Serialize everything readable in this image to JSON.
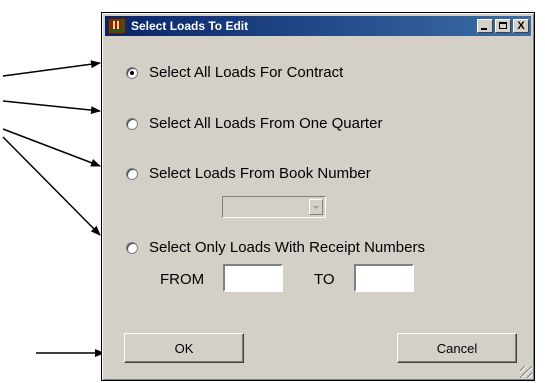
{
  "window": {
    "title": "Select Loads To Edit",
    "minimize_label": "_",
    "close_label": "X"
  },
  "options": [
    {
      "label": "Select All Loads For Contract",
      "selected": true
    },
    {
      "label": "Select All Loads From One Quarter",
      "selected": false
    },
    {
      "label": "Select Loads From Book Number",
      "selected": false
    },
    {
      "label": "Select Only Loads With Receipt Numbers",
      "selected": false
    }
  ],
  "book_number_combo": {
    "value": "",
    "enabled": false
  },
  "receipt_range": {
    "from_label": "FROM",
    "to_label": "TO",
    "from_value": "",
    "to_value": ""
  },
  "buttons": {
    "ok_label": "OK",
    "cancel_label": "Cancel"
  },
  "colors": {
    "dialog_bg": "#d4d0c8",
    "title_bar_start": "#0a246a",
    "title_bar_end": "#3a6ea5"
  }
}
